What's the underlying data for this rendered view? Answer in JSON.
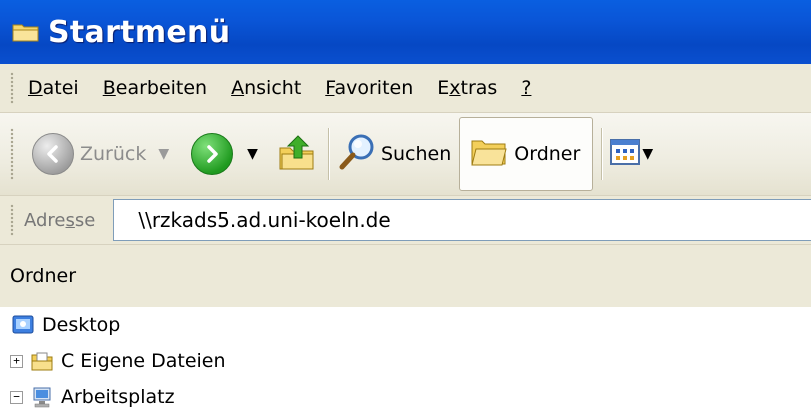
{
  "window": {
    "title": "Startmenü"
  },
  "menu": {
    "items": [
      {
        "pre": "",
        "key": "D",
        "post": "atei"
      },
      {
        "pre": "",
        "key": "B",
        "post": "earbeiten"
      },
      {
        "pre": "",
        "key": "A",
        "post": "nsicht"
      },
      {
        "pre": "",
        "key": "F",
        "post": "avoriten"
      },
      {
        "pre": "E",
        "key": "x",
        "post": "tras"
      },
      {
        "pre": "",
        "key": "?",
        "post": ""
      }
    ]
  },
  "toolbar": {
    "back_label": "Zurück",
    "search_label": "Suchen",
    "folders_label": "Ordner"
  },
  "address": {
    "label_pre": "Adre",
    "label_key": "s",
    "label_post": "se",
    "value": "\\\\rzkads5.ad.uni-koeln.de"
  },
  "folders_panel": {
    "title": "Ordner",
    "items": [
      {
        "label": "Desktop",
        "expander": "",
        "icon": "desktop-icon"
      },
      {
        "label": "C Eigene Dateien",
        "expander": "+",
        "icon": "my-documents-icon"
      },
      {
        "label": "Arbeitsplatz",
        "expander": "−",
        "icon": "my-computer-icon"
      }
    ]
  }
}
